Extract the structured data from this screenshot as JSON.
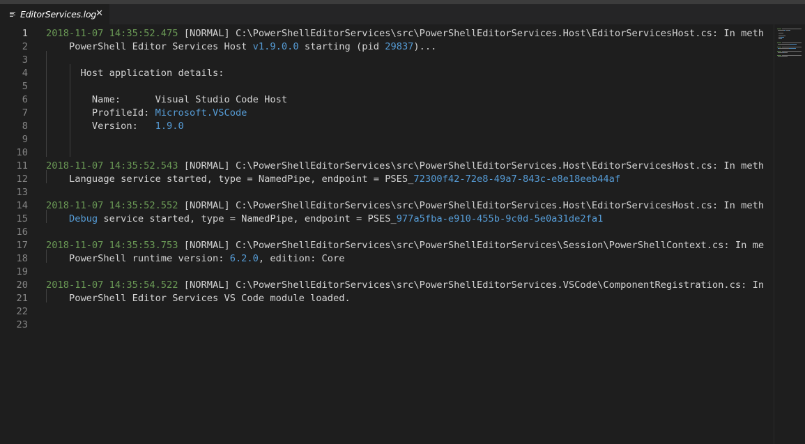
{
  "tab": {
    "label": "EditorServices.log",
    "close_glyph": "✕",
    "icon": "file-lines-icon"
  },
  "editor": {
    "active_line": 1,
    "lines": [
      {
        "n": "1",
        "segments": [
          {
            "t": "2018-11-07 14:35:52.475",
            "c": "ts"
          },
          {
            "t": " [NORMAL] C:\\PowerShellEditorServices\\src\\PowerShellEditorServices.Host\\EditorServicesHost.cs: In meth",
            "c": ""
          }
        ]
      },
      {
        "n": "2",
        "segments": [
          {
            "t": "    PowerShell Editor Services Host ",
            "c": ""
          },
          {
            "t": "v1.9.0.0",
            "c": "num"
          },
          {
            "t": " starting (pid ",
            "c": ""
          },
          {
            "t": "29837",
            "c": "num"
          },
          {
            "t": ")...",
            "c": ""
          }
        ]
      },
      {
        "n": "3",
        "segments": []
      },
      {
        "n": "4",
        "segments": [
          {
            "t": "      Host application details:",
            "c": ""
          }
        ]
      },
      {
        "n": "5",
        "segments": []
      },
      {
        "n": "6",
        "segments": [
          {
            "t": "        Name:      Visual Studio Code Host",
            "c": ""
          }
        ]
      },
      {
        "n": "7",
        "segments": [
          {
            "t": "        ProfileId: ",
            "c": ""
          },
          {
            "t": "Microsoft.VSCode",
            "c": "num"
          }
        ]
      },
      {
        "n": "8",
        "segments": [
          {
            "t": "        Version:   ",
            "c": ""
          },
          {
            "t": "1.9.0",
            "c": "num"
          }
        ]
      },
      {
        "n": "9",
        "segments": []
      },
      {
        "n": "10",
        "segments": []
      },
      {
        "n": "11",
        "segments": [
          {
            "t": "2018-11-07 14:35:52.543",
            "c": "ts"
          },
          {
            "t": " [NORMAL] C:\\PowerShellEditorServices\\src\\PowerShellEditorServices.Host\\EditorServicesHost.cs: In meth",
            "c": ""
          }
        ]
      },
      {
        "n": "12",
        "segments": [
          {
            "t": "    Language service started, type = NamedPipe, endpoint = PSES_",
            "c": ""
          },
          {
            "t": "72300f42-72e8-49a7-843c-e8e18eeb44af",
            "c": "num"
          }
        ]
      },
      {
        "n": "13",
        "segments": []
      },
      {
        "n": "14",
        "segments": [
          {
            "t": "2018-11-07 14:35:52.552",
            "c": "ts"
          },
          {
            "t": " [NORMAL] C:\\PowerShellEditorServices\\src\\PowerShellEditorServices.Host\\EditorServicesHost.cs: In meth",
            "c": ""
          }
        ]
      },
      {
        "n": "15",
        "segments": [
          {
            "t": "    ",
            "c": ""
          },
          {
            "t": "Debug",
            "c": "num"
          },
          {
            "t": " service started, type = NamedPipe, endpoint = PSES_",
            "c": ""
          },
          {
            "t": "977a5fba-e910-455b-9c0d-5e0a31de2fa1",
            "c": "num"
          }
        ]
      },
      {
        "n": "16",
        "segments": []
      },
      {
        "n": "17",
        "segments": [
          {
            "t": "2018-11-07 14:35:53.753",
            "c": "ts"
          },
          {
            "t": " [NORMAL] C:\\PowerShellEditorServices\\src\\PowerShellEditorServices\\Session\\PowerShellContext.cs: In me",
            "c": ""
          }
        ]
      },
      {
        "n": "18",
        "segments": [
          {
            "t": "    PowerShell runtime version: ",
            "c": ""
          },
          {
            "t": "6.2.0",
            "c": "num"
          },
          {
            "t": ", edition: Core",
            "c": ""
          }
        ]
      },
      {
        "n": "19",
        "segments": []
      },
      {
        "n": "20",
        "segments": [
          {
            "t": "2018-11-07 14:35:54.522",
            "c": "ts"
          },
          {
            "t": " [NORMAL] C:\\PowerShellEditorServices\\src\\PowerShellEditorServices.VSCode\\ComponentRegistration.cs: In",
            "c": ""
          }
        ]
      },
      {
        "n": "21",
        "segments": [
          {
            "t": "    PowerShell Editor Services VS Code module loaded.",
            "c": ""
          }
        ]
      },
      {
        "n": "22",
        "segments": []
      },
      {
        "n": "23",
        "segments": []
      }
    ]
  },
  "colors": {
    "background": "#1e1e1e",
    "timestamp": "#6a9955",
    "number": "#569cd6",
    "text": "#d4d4d4",
    "line_number": "#858585"
  }
}
